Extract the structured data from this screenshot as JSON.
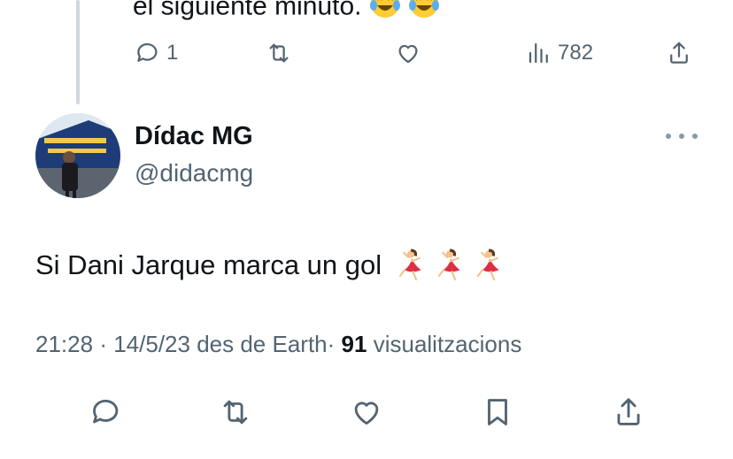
{
  "previous_tweet": {
    "text_fragment": "el siguiente minuto.",
    "emojis": [
      "tears-of-joy-emoji",
      "tears-of-joy-emoji"
    ],
    "reply_count": "1",
    "views_count": "782",
    "icons": [
      "reply-icon",
      "retweet-icon",
      "like-icon",
      "views-icon",
      "share-icon"
    ]
  },
  "tweet": {
    "display_name": "Dídac MG",
    "handle": "@didacmg",
    "text": "Si Dani Jarque marca un gol",
    "text_emojis": [
      "dancer-emoji",
      "dancer-emoji",
      "dancer-emoji"
    ],
    "time": "21:28",
    "date": "14/5/23",
    "source": "des de Earth",
    "views_count": "91",
    "views_label": "visualitzacions",
    "separator": "·",
    "icons": [
      "reply-icon",
      "retweet-icon",
      "like-icon",
      "bookmark-icon",
      "share-icon"
    ]
  },
  "colors": {
    "text_primary": "#0f1419",
    "text_secondary": "#536471",
    "thread_line": "#cfd9de",
    "background": "#ffffff"
  }
}
